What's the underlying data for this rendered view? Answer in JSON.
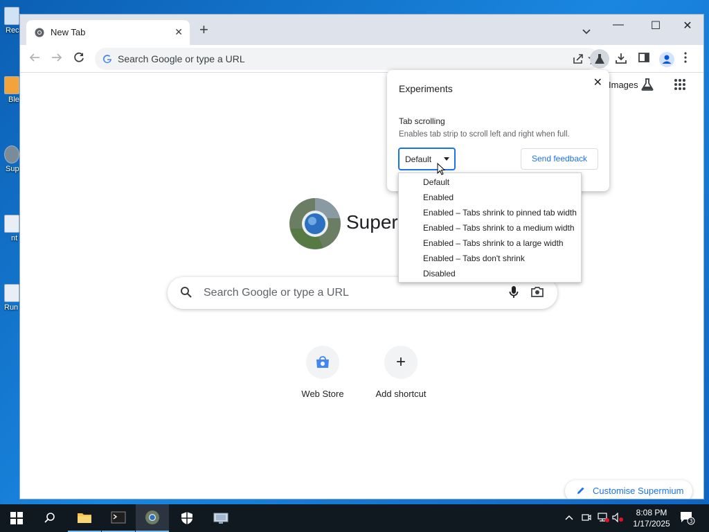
{
  "desktop": {
    "icons": [
      {
        "label": "Rec"
      },
      {
        "label": "Ble"
      },
      {
        "label": "Sup"
      },
      {
        "label": "nt"
      },
      {
        "label": "Run"
      }
    ]
  },
  "browser": {
    "tab": {
      "title": "New Tab"
    },
    "omnibox": {
      "placeholder": "Search Google or type a URL"
    },
    "ntp": {
      "images_link": "Images",
      "logo_text": "Superm",
      "search_placeholder": "Search Google or type a URL",
      "shortcuts": [
        {
          "label": "Web Store"
        },
        {
          "label": "Add shortcut"
        }
      ],
      "customise_label": "Customise Supermium"
    },
    "experiments": {
      "title": "Experiments",
      "feature_name": "Tab scrolling",
      "feature_desc": "Enables tab strip to scroll left and right when full.",
      "selected_value": "Default",
      "send_feedback": "Send feedback",
      "options": [
        "Default",
        "Enabled",
        "Enabled – Tabs shrink to pinned tab width",
        "Enabled – Tabs shrink to a medium width",
        "Enabled – Tabs shrink to a large width",
        "Enabled – Tabs don't shrink",
        "Disabled"
      ]
    }
  },
  "taskbar": {
    "time": "8:08 PM",
    "date": "1/17/2025",
    "notification_count": "3"
  },
  "colors": {
    "accent": "#1a73e8",
    "taskbar": "#101820",
    "tabstrip": "#dee3eb"
  }
}
